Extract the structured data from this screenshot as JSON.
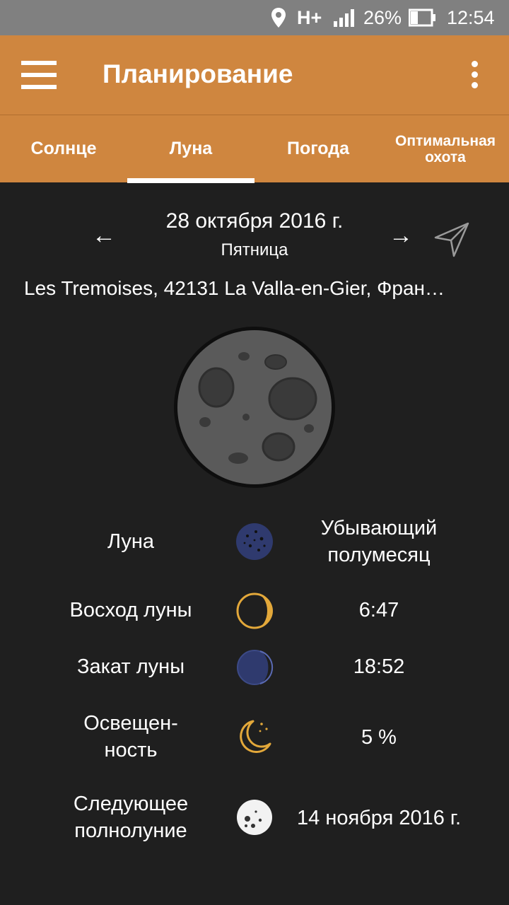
{
  "status_bar": {
    "network": "H+",
    "battery_percent": "26%",
    "time": "12:54"
  },
  "app_bar": {
    "title": "Планирование"
  },
  "tabs": [
    {
      "label": "Солнце",
      "selected": false
    },
    {
      "label": "Луна",
      "selected": true
    },
    {
      "label": "Погода",
      "selected": false
    },
    {
      "label": "Оптимальная охота",
      "selected": false
    }
  ],
  "date_nav": {
    "prev": "←",
    "date": "28 октября 2016 г.",
    "weekday": "Пятница",
    "next": "→"
  },
  "location": "Les Tremoises, 42131 La Valla-en-Gier, Фран…",
  "moon_info": [
    {
      "label": "Луна",
      "icon": "moon-phase-icon",
      "value": "Убывающий полумесяц"
    },
    {
      "label": "Восход луны",
      "icon": "moonrise-icon",
      "value": "6:47"
    },
    {
      "label": "Закат луны",
      "icon": "moonset-icon",
      "value": "18:52"
    },
    {
      "label": "Освещен-ность",
      "icon": "crescent-stars-icon",
      "value": "5 %"
    },
    {
      "label": "Следующее полнолуние",
      "icon": "full-moon-icon",
      "value": "14 ноября 2016 г."
    }
  ],
  "colors": {
    "accent": "#cf863f",
    "background": "#1f1f1f",
    "icon_gold": "#e3a83a",
    "icon_navy": "#2f3a6e"
  }
}
